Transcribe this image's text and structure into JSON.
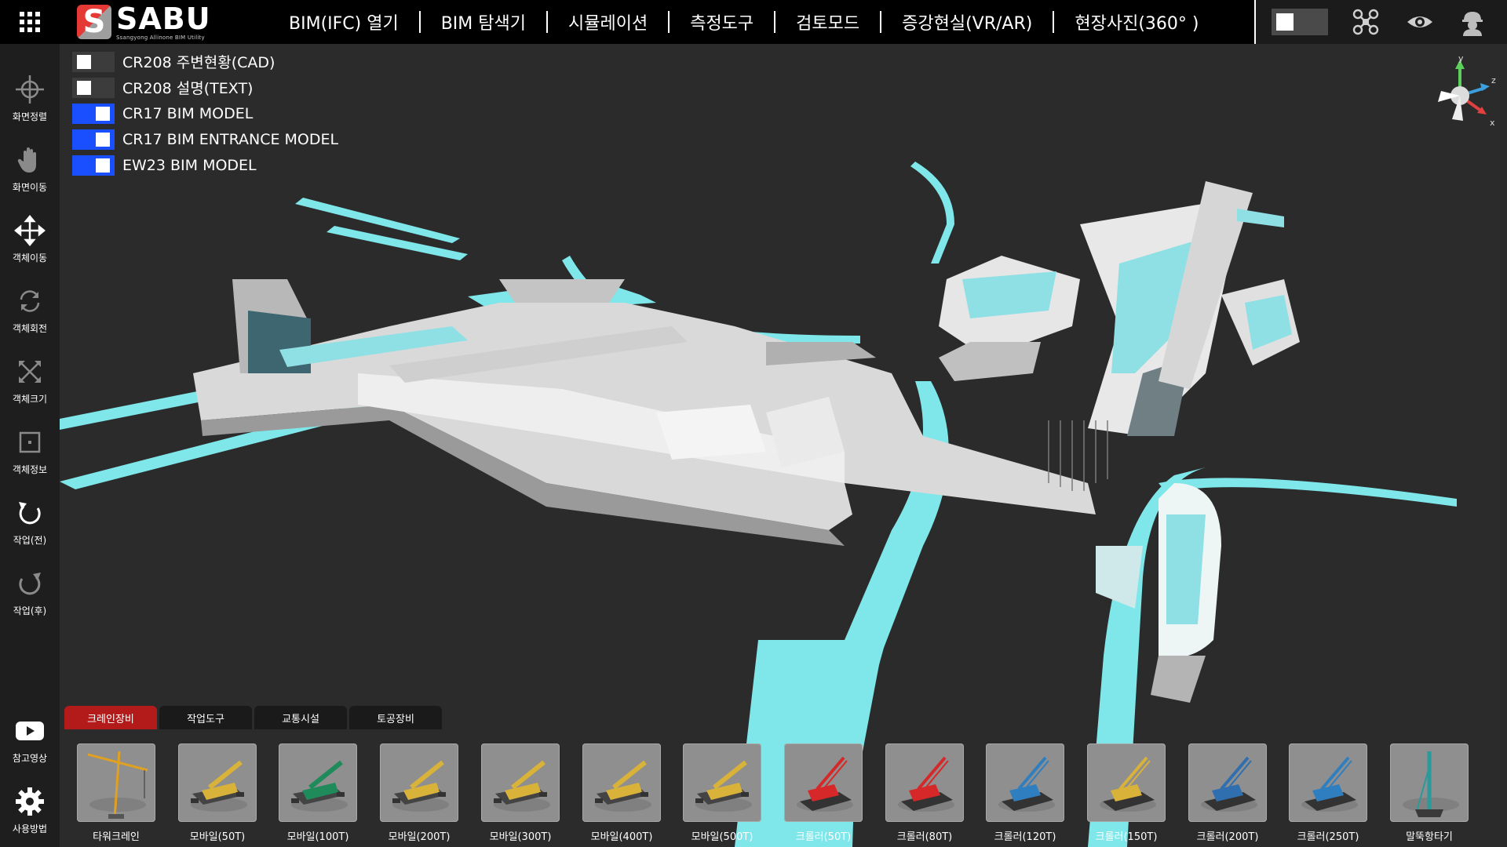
{
  "app": {
    "logo_letter": "S",
    "logo_name": "SABU",
    "logo_sub": "Ssangyong Allinone BIM Utility"
  },
  "menu": [
    {
      "label": "BIM(IFC) 열기"
    },
    {
      "label": "BIM 탐색기"
    },
    {
      "label": "시뮬레이션"
    },
    {
      "label": "측정도구"
    },
    {
      "label": "검토모드"
    },
    {
      "label": "증강현실(VR/AR)"
    },
    {
      "label": "현장사진(360° )"
    }
  ],
  "top_right": {
    "toggle_on": false,
    "icons": [
      "drone-icon",
      "eye-icon",
      "worker-helmet-icon"
    ]
  },
  "sidebar": {
    "tools": [
      {
        "label": "화면정렬",
        "icon": "crosshair-icon"
      },
      {
        "label": "화면이동",
        "icon": "hand-icon"
      },
      {
        "label": "객체이동",
        "icon": "move-arrows-icon"
      },
      {
        "label": "객체회전",
        "icon": "rotate-icon"
      },
      {
        "label": "객체크기",
        "icon": "scale-icon"
      },
      {
        "label": "객체정보",
        "icon": "info-box-icon"
      },
      {
        "label": "작업(전)",
        "icon": "undo-icon"
      },
      {
        "label": "작업(후)",
        "icon": "redo-icon"
      }
    ],
    "bottom": [
      {
        "label": "참고영상",
        "icon": "youtube-icon"
      },
      {
        "label": "사용방법",
        "icon": "gear-icon"
      }
    ]
  },
  "layers": [
    {
      "name": "CR208 주변현황(CAD)",
      "on": false
    },
    {
      "name": "CR208 설명(TEXT)",
      "on": false
    },
    {
      "name": "CR17 BIM MODEL",
      "on": true
    },
    {
      "name": "CR17 BIM ENTRANCE MODEL",
      "on": true
    },
    {
      "name": "EW23 BIM MODEL",
      "on": true
    }
  ],
  "axis_labels": {
    "y": "y",
    "z": "z",
    "x": "x"
  },
  "tabs": [
    {
      "label": "크레인장비",
      "active": true
    },
    {
      "label": "작업도구",
      "active": false
    },
    {
      "label": "교통시설",
      "active": false
    },
    {
      "label": "토공장비",
      "active": false
    }
  ],
  "equipment": [
    {
      "label": "타워크레인",
      "color": "#e0a020",
      "kind": "tower"
    },
    {
      "label": "모바일(50T)",
      "color": "#d9b23a",
      "kind": "mobile"
    },
    {
      "label": "모바일(100T)",
      "color": "#1f8a5a",
      "kind": "mobile"
    },
    {
      "label": "모바일(200T)",
      "color": "#d9b23a",
      "kind": "mobile"
    },
    {
      "label": "모바일(300T)",
      "color": "#d9b23a",
      "kind": "mobile"
    },
    {
      "label": "모바일(400T)",
      "color": "#d9b23a",
      "kind": "mobile"
    },
    {
      "label": "모바일(500T)",
      "color": "#d9b23a",
      "kind": "mobile"
    },
    {
      "label": "크롤러(50T)",
      "color": "#d62828",
      "kind": "crawler"
    },
    {
      "label": "크롤러(80T)",
      "color": "#d62828",
      "kind": "crawler"
    },
    {
      "label": "크롤러(120T)",
      "color": "#2f7fc0",
      "kind": "crawler"
    },
    {
      "label": "크롤러(150T)",
      "color": "#d9b23a",
      "kind": "crawler"
    },
    {
      "label": "크롤러(200T)",
      "color": "#2f6fb0",
      "kind": "crawler"
    },
    {
      "label": "크롤러(250T)",
      "color": "#2f7fc0",
      "kind": "crawler"
    },
    {
      "label": "말뚝항타기",
      "color": "#2a9a9a",
      "kind": "pile"
    }
  ]
}
